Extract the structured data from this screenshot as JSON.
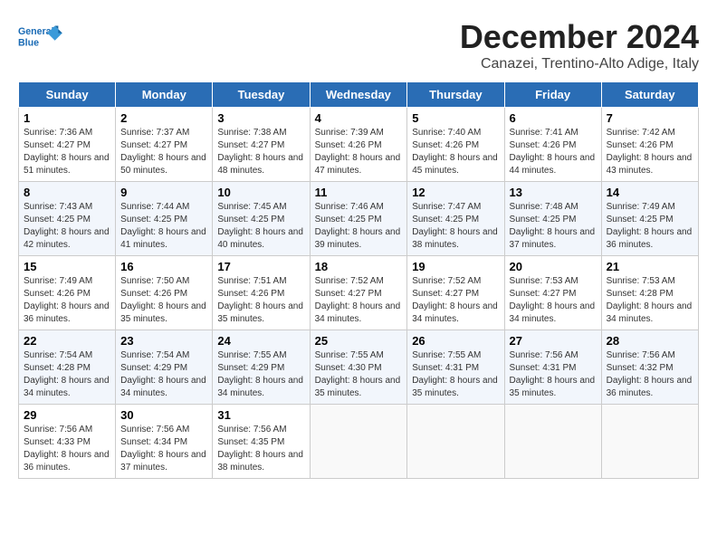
{
  "header": {
    "logo_line1": "General",
    "logo_line2": "Blue",
    "month": "December 2024",
    "location": "Canazei, Trentino-Alto Adige, Italy"
  },
  "weekdays": [
    "Sunday",
    "Monday",
    "Tuesday",
    "Wednesday",
    "Thursday",
    "Friday",
    "Saturday"
  ],
  "weeks": [
    [
      {
        "day": "1",
        "info": "Sunrise: 7:36 AM\nSunset: 4:27 PM\nDaylight: 8 hours and 51 minutes."
      },
      {
        "day": "2",
        "info": "Sunrise: 7:37 AM\nSunset: 4:27 PM\nDaylight: 8 hours and 50 minutes."
      },
      {
        "day": "3",
        "info": "Sunrise: 7:38 AM\nSunset: 4:27 PM\nDaylight: 8 hours and 48 minutes."
      },
      {
        "day": "4",
        "info": "Sunrise: 7:39 AM\nSunset: 4:26 PM\nDaylight: 8 hours and 47 minutes."
      },
      {
        "day": "5",
        "info": "Sunrise: 7:40 AM\nSunset: 4:26 PM\nDaylight: 8 hours and 45 minutes."
      },
      {
        "day": "6",
        "info": "Sunrise: 7:41 AM\nSunset: 4:26 PM\nDaylight: 8 hours and 44 minutes."
      },
      {
        "day": "7",
        "info": "Sunrise: 7:42 AM\nSunset: 4:26 PM\nDaylight: 8 hours and 43 minutes."
      }
    ],
    [
      {
        "day": "8",
        "info": "Sunrise: 7:43 AM\nSunset: 4:25 PM\nDaylight: 8 hours and 42 minutes."
      },
      {
        "day": "9",
        "info": "Sunrise: 7:44 AM\nSunset: 4:25 PM\nDaylight: 8 hours and 41 minutes."
      },
      {
        "day": "10",
        "info": "Sunrise: 7:45 AM\nSunset: 4:25 PM\nDaylight: 8 hours and 40 minutes."
      },
      {
        "day": "11",
        "info": "Sunrise: 7:46 AM\nSunset: 4:25 PM\nDaylight: 8 hours and 39 minutes."
      },
      {
        "day": "12",
        "info": "Sunrise: 7:47 AM\nSunset: 4:25 PM\nDaylight: 8 hours and 38 minutes."
      },
      {
        "day": "13",
        "info": "Sunrise: 7:48 AM\nSunset: 4:25 PM\nDaylight: 8 hours and 37 minutes."
      },
      {
        "day": "14",
        "info": "Sunrise: 7:49 AM\nSunset: 4:25 PM\nDaylight: 8 hours and 36 minutes."
      }
    ],
    [
      {
        "day": "15",
        "info": "Sunrise: 7:49 AM\nSunset: 4:26 PM\nDaylight: 8 hours and 36 minutes."
      },
      {
        "day": "16",
        "info": "Sunrise: 7:50 AM\nSunset: 4:26 PM\nDaylight: 8 hours and 35 minutes."
      },
      {
        "day": "17",
        "info": "Sunrise: 7:51 AM\nSunset: 4:26 PM\nDaylight: 8 hours and 35 minutes."
      },
      {
        "day": "18",
        "info": "Sunrise: 7:52 AM\nSunset: 4:27 PM\nDaylight: 8 hours and 34 minutes."
      },
      {
        "day": "19",
        "info": "Sunrise: 7:52 AM\nSunset: 4:27 PM\nDaylight: 8 hours and 34 minutes."
      },
      {
        "day": "20",
        "info": "Sunrise: 7:53 AM\nSunset: 4:27 PM\nDaylight: 8 hours and 34 minutes."
      },
      {
        "day": "21",
        "info": "Sunrise: 7:53 AM\nSunset: 4:28 PM\nDaylight: 8 hours and 34 minutes."
      }
    ],
    [
      {
        "day": "22",
        "info": "Sunrise: 7:54 AM\nSunset: 4:28 PM\nDaylight: 8 hours and 34 minutes."
      },
      {
        "day": "23",
        "info": "Sunrise: 7:54 AM\nSunset: 4:29 PM\nDaylight: 8 hours and 34 minutes."
      },
      {
        "day": "24",
        "info": "Sunrise: 7:55 AM\nSunset: 4:29 PM\nDaylight: 8 hours and 34 minutes."
      },
      {
        "day": "25",
        "info": "Sunrise: 7:55 AM\nSunset: 4:30 PM\nDaylight: 8 hours and 35 minutes."
      },
      {
        "day": "26",
        "info": "Sunrise: 7:55 AM\nSunset: 4:31 PM\nDaylight: 8 hours and 35 minutes."
      },
      {
        "day": "27",
        "info": "Sunrise: 7:56 AM\nSunset: 4:31 PM\nDaylight: 8 hours and 35 minutes."
      },
      {
        "day": "28",
        "info": "Sunrise: 7:56 AM\nSunset: 4:32 PM\nDaylight: 8 hours and 36 minutes."
      }
    ],
    [
      {
        "day": "29",
        "info": "Sunrise: 7:56 AM\nSunset: 4:33 PM\nDaylight: 8 hours and 36 minutes."
      },
      {
        "day": "30",
        "info": "Sunrise: 7:56 AM\nSunset: 4:34 PM\nDaylight: 8 hours and 37 minutes."
      },
      {
        "day": "31",
        "info": "Sunrise: 7:56 AM\nSunset: 4:35 PM\nDaylight: 8 hours and 38 minutes."
      },
      null,
      null,
      null,
      null
    ]
  ]
}
